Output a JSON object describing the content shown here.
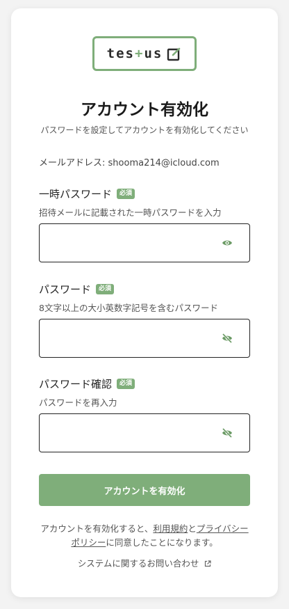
{
  "logo": {
    "text_before": "tes",
    "plus": "+",
    "text_after": "us",
    "icon": "edit-square-icon"
  },
  "header": {
    "title": "アカウント有効化",
    "subtitle": "パスワードを設定してアカウントを有効化してください"
  },
  "email": {
    "label": "メールアドレス:",
    "value": "shooma214@icloud.com"
  },
  "fields": [
    {
      "label": "一時パスワード",
      "badge": "必須",
      "help": "招待メールに記載された一時パスワードを入力",
      "value": "",
      "icon": "eye-icon"
    },
    {
      "label": "パスワード",
      "badge": "必須",
      "help": "8文字以上の大小英数字記号を含むパスワード",
      "value": "",
      "icon": "eye-off-icon"
    },
    {
      "label": "パスワード確認",
      "badge": "必須",
      "help": "パスワードを再入力",
      "value": "",
      "icon": "eye-off-icon"
    }
  ],
  "submit": {
    "label": "アカウントを有効化"
  },
  "terms": {
    "before": "アカウントを有効化すると、",
    "link1": "利用規約",
    "and": "と",
    "link2": "プライバシーポリシー",
    "after": "に同意したことになります。"
  },
  "contact": {
    "label": "システムに関するお問い合わせ",
    "icon": "external-link-icon"
  },
  "colors": {
    "accent": "#7fae7a",
    "text": "#222222",
    "muted": "#555555"
  }
}
